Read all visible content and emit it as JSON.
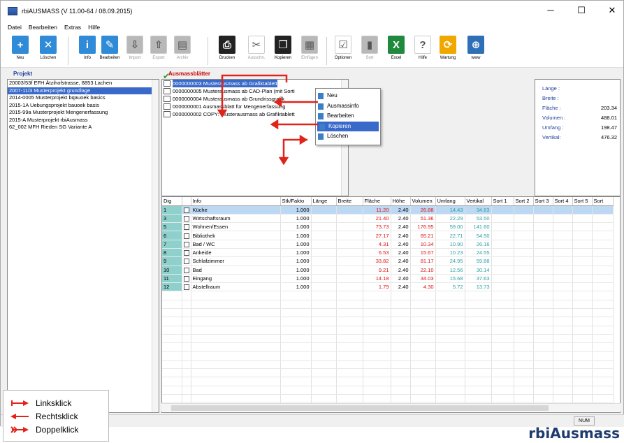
{
  "window": {
    "title": "rbiAUSMASS (V 11.00-64 / 08.09.2015)",
    "controls": {
      "minimize": "─",
      "maximize": "☐",
      "close": "✕"
    }
  },
  "menu": [
    "Datei",
    "Bearbeiten",
    "Extras",
    "Hilfe"
  ],
  "toolbar": [
    {
      "label": "Neu",
      "icon": "new-doc-icon",
      "color": "#2f8ad8",
      "glyph": "+"
    },
    {
      "label": "Löschen",
      "icon": "delete-doc-icon",
      "color": "#2f8ad8",
      "glyph": "✕"
    },
    {
      "label": "Info",
      "icon": "info-icon",
      "color": "#2f8ad8",
      "glyph": "i"
    },
    {
      "label": "Bearbeiten",
      "icon": "edit-icon",
      "color": "#2f8ad8",
      "glyph": "✎"
    },
    {
      "label": "Import",
      "icon": "import-icon",
      "color": "#b8b8b8",
      "glyph": "⇩"
    },
    {
      "label": "Export",
      "icon": "export-icon",
      "color": "#b8b8b8",
      "glyph": "⇧"
    },
    {
      "label": "Archiv",
      "icon": "archive-icon",
      "color": "#b8b8b8",
      "glyph": "▤"
    },
    {
      "label": "Drucken",
      "icon": "printer-icon",
      "color": "#222",
      "glyph": "⎙"
    },
    {
      "label": "Ausschn.",
      "icon": "scissors-icon",
      "color": "#fff",
      "glyph": "✂"
    },
    {
      "label": "Kopieren",
      "icon": "copy-icon",
      "color": "#222",
      "glyph": "❐"
    },
    {
      "label": "Einfügen",
      "icon": "paste-icon",
      "color": "#b8b8b8",
      "glyph": "▦"
    },
    {
      "label": "Optionen",
      "icon": "options-icon",
      "color": "#fff",
      "glyph": "☑"
    },
    {
      "label": "Sort",
      "icon": "sort-icon",
      "color": "#b8b8b8",
      "glyph": "▮"
    },
    {
      "label": "Excel",
      "icon": "excel-icon",
      "color": "#1f8a3e",
      "glyph": "X"
    },
    {
      "label": "Hilfe",
      "icon": "help-icon",
      "color": "#fff",
      "glyph": "?"
    },
    {
      "label": "Wartung",
      "icon": "maintenance-icon",
      "color": "#f0a800",
      "glyph": "⟳"
    },
    {
      "label": "www",
      "icon": "globe-icon",
      "color": "#2f6fb8",
      "glyph": "⊕"
    }
  ],
  "projekt": {
    "heading": "Projekt",
    "items": [
      "20003/53f EFH Ätzihofstrasse, 8853 Lachen",
      "2007-11/3 Musterprojekt grundlage",
      "2014-0005 Musterprojekt bqauoek basics",
      "2015-1A  Uebungsprojekt bauoek basis",
      "2015-99a Musterprojekt Mengenerfassung",
      "2015-A   Musterprojekt rbiAusmass",
      "62_002   MFH Rieden SG Variante A"
    ],
    "selected": 1
  },
  "ausmass": {
    "heading": "Ausmassblätter",
    "items": [
      "0000000003  Musterausmass ab Grafiktablett",
      "0000000005  Musterausmass ab CAD-Plan (mit Sorti",
      "0000000004  Musterausmass ab Grundrissgrafik",
      "0000000001  Ausmassblatt für Mengenerfassung",
      "0000000002  COPY: Musterausmass ab Grafiktablett"
    ],
    "selected": 0
  },
  "context_menu": {
    "items": [
      "Neu",
      "Ausmassinfo",
      "Bearbeiten",
      "Kopieren",
      "Löschen"
    ],
    "selected": 3
  },
  "info": {
    "rows": [
      {
        "k": "Länge :",
        "v": ""
      },
      {
        "k": "Breite :",
        "v": ""
      },
      {
        "k": "Fläche :",
        "v": "203.34"
      },
      {
        "k": "Volumen :",
        "v": "488.01"
      },
      {
        "k": "Umfang :",
        "v": "198.47"
      },
      {
        "k": "Vertikal:",
        "v": "476.32"
      }
    ]
  },
  "grid": {
    "columns": [
      "Dig",
      "",
      "Info",
      "Stk/Fakto",
      "Länge",
      "Breite",
      "Fläche",
      "Höhe",
      "Volumen",
      "Umfang",
      "Vertikal",
      "Sort 1",
      "Sort 2",
      "Sort 3",
      "Sort 4",
      "Sort 5",
      "Sort"
    ],
    "rows": [
      {
        "dig": "1",
        "info": "Küche",
        "stk": "1.000",
        "flaeche": "11.20",
        "hoehe": "2.40",
        "volumen": "26.88",
        "umfang": "14.43",
        "vertikal": "34.63"
      },
      {
        "dig": "3",
        "info": "Wirtschaftsraum",
        "stk": "1.000",
        "flaeche": "21.40",
        "hoehe": "2.40",
        "volumen": "51.36",
        "umfang": "22.29",
        "vertikal": "53.50"
      },
      {
        "dig": "5",
        "info": "Wohnen/Essen",
        "stk": "1.000",
        "flaeche": "73.73",
        "hoehe": "2.40",
        "volumen": "176.95",
        "umfang": "59.00",
        "vertikal": "141.60"
      },
      {
        "dig": "6",
        "info": "Bibliothek",
        "stk": "1.000",
        "flaeche": "27.17",
        "hoehe": "2.40",
        "volumen": "65.21",
        "umfang": "22.71",
        "vertikal": "54.50"
      },
      {
        "dig": "7",
        "info": "Bad / WC",
        "stk": "1.000",
        "flaeche": "4.31",
        "hoehe": "2.40",
        "volumen": "10.34",
        "umfang": "10.90",
        "vertikal": "26.16"
      },
      {
        "dig": "8",
        "info": "Ankeide",
        "stk": "1.000",
        "flaeche": "6.53",
        "hoehe": "2.40",
        "volumen": "15.67",
        "umfang": "10.23",
        "vertikal": "24.55"
      },
      {
        "dig": "9",
        "info": "Schlafzimmer",
        "stk": "1.000",
        "flaeche": "33.82",
        "hoehe": "2.40",
        "volumen": "81.17",
        "umfang": "24.95",
        "vertikal": "59.88"
      },
      {
        "dig": "10",
        "info": "Bad",
        "stk": "1.000",
        "flaeche": "9.21",
        "hoehe": "2.40",
        "volumen": "22.10",
        "umfang": "12.56",
        "vertikal": "30.14"
      },
      {
        "dig": "11",
        "info": "Eingang",
        "stk": "1.000",
        "flaeche": "14.18",
        "hoehe": "2.40",
        "volumen": "34.03",
        "umfang": "15.68",
        "vertikal": "37.63"
      },
      {
        "dig": "12",
        "info": "Abstellraum",
        "stk": "1.000",
        "flaeche": "1.79",
        "hoehe": "2.40",
        "volumen": "4.30",
        "umfang": "5.72",
        "vertikal": "13.73"
      }
    ],
    "selected": 0
  },
  "status": {
    "num": "NUM"
  },
  "legend": [
    "Linksklick",
    "Rechtsklick",
    "Doppelklick"
  ],
  "brand": "rbiAusmass",
  "colors": {
    "accent": "#3969c9",
    "arrow": "#e0241b",
    "flaeche": "#d11",
    "umfang": "#2a9fa6"
  }
}
